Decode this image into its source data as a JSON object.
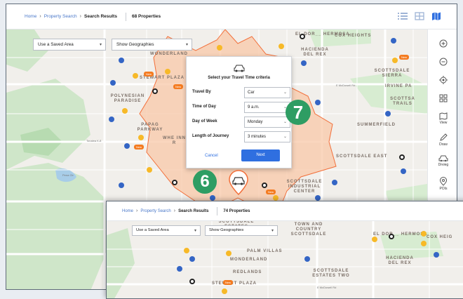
{
  "main": {
    "breadcrumb": {
      "home": "Home",
      "search": "Property Search",
      "current": "Search Results"
    },
    "count": "68 Properties",
    "saved_area": "Use a Saved Area",
    "geographies": "Show Geographies"
  },
  "modal": {
    "title": "Select your Travel Time criteria",
    "fields": [
      {
        "label": "Travel By",
        "value": "Car"
      },
      {
        "label": "Time of Day",
        "value": "9 a.m."
      },
      {
        "label": "Day of Week",
        "value": "Monday"
      },
      {
        "label": "Length of Journey",
        "value": "3 minutes"
      }
    ],
    "cancel": "Cancel",
    "next": "Next"
  },
  "callouts": {
    "six": "6",
    "seven": "7"
  },
  "tools": {
    "view": "View",
    "draw": "Draw",
    "drive": "Drvieg",
    "pois": "POIs"
  },
  "map_labels": {
    "el_dorado_hermosa": "EL DOR__ HERMOSA",
    "cox_heights": "COX HEIGHTS",
    "hacienda": "HACIENDA DEL REX",
    "scottsdale_sierra": "SCOTTSDALE SIERRA",
    "irvine_pa": "IRVINE PA",
    "scottsdale_trails": "SCOTTSA TRAILS",
    "summerfield": "SUMMERFIELD",
    "scottsdale_east": "SCOTTSDALE EAST",
    "scottsdale_industrial": "SCOTTSDALE INDUSTRIAL CENTER",
    "polynesian": "POLYNESIAN PARADISE",
    "papago": "PAPAG PARKWAY",
    "wonderland": "WONDERLAND",
    "stewart_plaza": "STEWART PLAZA",
    "wher_inn": "WHE INN R",
    "tonalea": "Tonalea K-8",
    "pena_ctr": "Pena Ctr",
    "mcdowell": "E McDowell Rd",
    "new_tag": "New"
  },
  "inset": {
    "breadcrumb": {
      "home": "Home",
      "search": "Property Search",
      "current": "Search Results"
    },
    "count": "74 Properties",
    "saved_area": "Use a Saved Area",
    "geographies": "Show Geographies",
    "labels": {
      "town_country": "TOWN AND COUNTRY SCOTTSDALE",
      "scottsdale_estates": "SCOTTSDALE ESTATES",
      "palm_villas": "PALM VILLAS",
      "monderland": "MONDERLAND",
      "redlands": "REDLANDS",
      "stewart_plaza": "STEWART PLAZA",
      "scottsdale_two": "SCOTTSDALE ESTATES TWO",
      "el_dorado": "EL DOR__ HERMOSA",
      "cox_heig": "COX HEIG",
      "hacienda": "HACIENDA DEL REX",
      "mcdowell": "E McDowell Rd"
    }
  },
  "colors": {
    "accent": "#2f6fe0",
    "badge": "#2e9d63",
    "polygon": "#f26f3a",
    "pin_blue": "#3465c5",
    "pin_yellow": "#f7b928"
  }
}
